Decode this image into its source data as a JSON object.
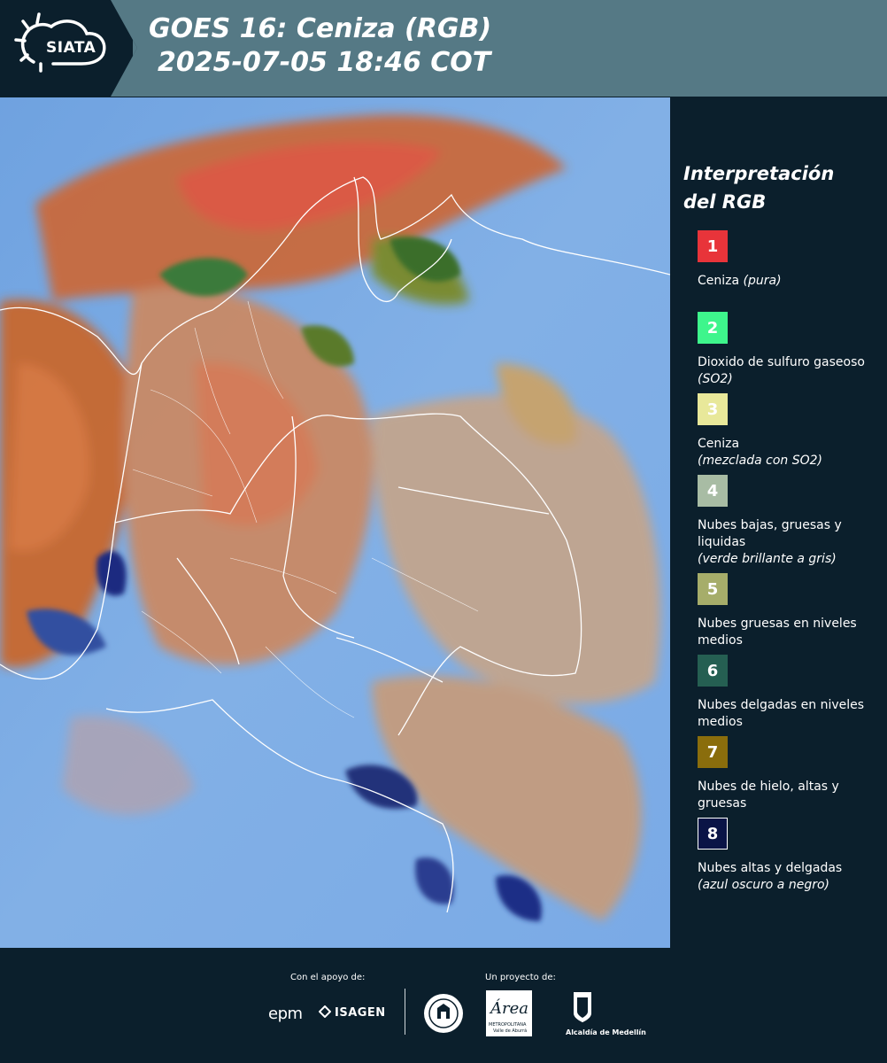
{
  "header": {
    "logo_text": "SIATA",
    "title_line1": "GOES 16: Ceniza (RGB)",
    "title_line2": "2025-07-05 18:46 COT"
  },
  "legend": {
    "title_line1": "Interpretación",
    "title_line2": "del RGB",
    "items": [
      {
        "number": "1",
        "color": "#e8343a",
        "text": "Ceniza",
        "italic": "(pura)"
      },
      {
        "number": "2",
        "color": "#3ef58c",
        "text": "Dioxido de sulfuro gaseoso",
        "italic": "(SO2)"
      },
      {
        "number": "3",
        "color": "#e8e89a",
        "text": "Ceniza",
        "italic": "(mezclada con SO2)"
      },
      {
        "number": "4",
        "color": "#a8bca4",
        "text": "Nubes bajas, gruesas y liquidas",
        "italic": "(verde brillante a gris)"
      },
      {
        "number": "5",
        "color": "#a6ad6a",
        "text": "Nubes gruesas en niveles medios",
        "italic": ""
      },
      {
        "number": "6",
        "color": "#255f52",
        "text": "Nubes delgadas en niveles medios",
        "italic": ""
      },
      {
        "number": "7",
        "color": "#8a6d0c",
        "text": "Nubes de hielo, altas y gruesas",
        "italic": ""
      },
      {
        "number": "8",
        "color": "#0a1446",
        "text": "Nubes altas y delgadas",
        "italic": "(azul oscuro a negro)"
      }
    ]
  },
  "footer": {
    "support_label": "Con el apoyo de:",
    "project_label": "Un proyecto de:",
    "epm": "epm",
    "isagen": "ISAGEN",
    "area_logo": "Área",
    "area_sub1": "METROPOLITANA",
    "area_sub2": "Valle de Aburrá",
    "alcaldia": "Alcaldía de Medellín"
  }
}
